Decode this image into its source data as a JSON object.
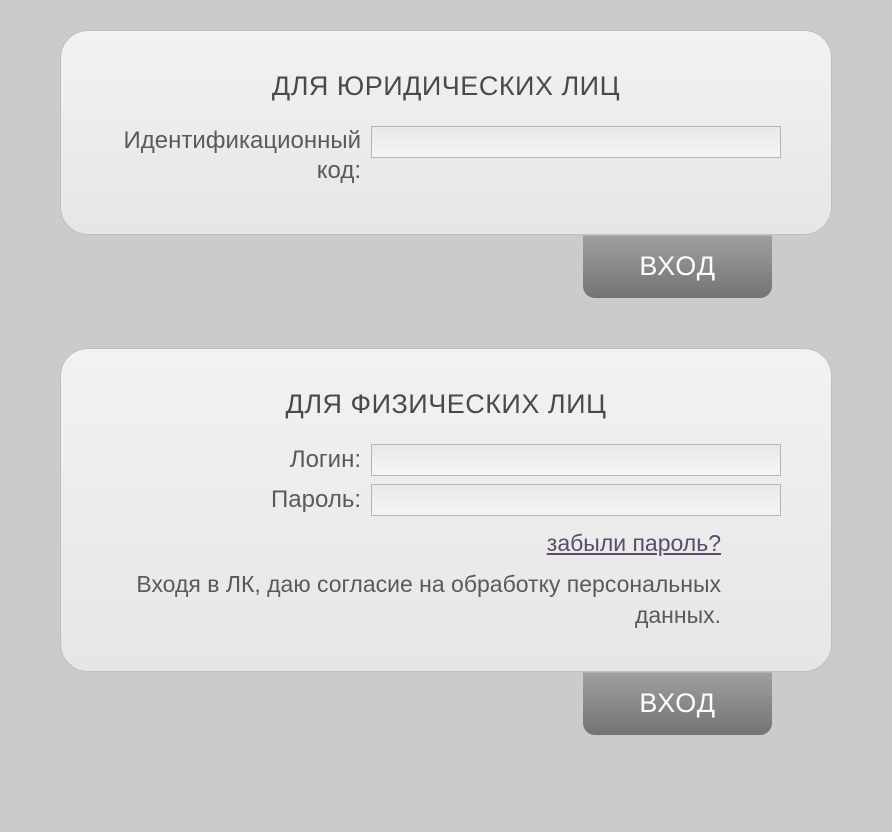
{
  "legal": {
    "title": "ДЛЯ ЮРИДИЧЕСКИХ ЛИЦ",
    "id_code_label": "Идентификационный код:",
    "submit_label": "ВХОД"
  },
  "individual": {
    "title": "ДЛЯ ФИЗИЧЕСКИХ ЛИЦ",
    "login_label": "Логин:",
    "password_label": "Пароль:",
    "forgot_label": "забыли пароль?",
    "consent_text": "Входя в ЛК, даю согласие на обработку персональных данных.",
    "submit_label": "ВХОД"
  }
}
